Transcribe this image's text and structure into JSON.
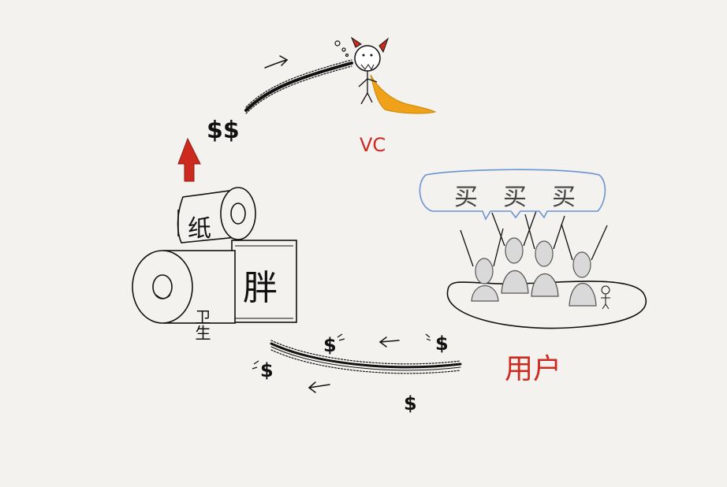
{
  "labels": {
    "vc": "VC",
    "users": "用户",
    "roll_top": "纸",
    "roll_front": "卫生",
    "roll_right": "胖",
    "speech": [
      "买",
      "买",
      "买"
    ],
    "money_top": "$$",
    "dollar": "$"
  },
  "colors": {
    "ink": "#111111",
    "red": "#cc2a1f",
    "orange": "#f0a11a",
    "blue": "#6a93d3",
    "paper": "#f4f2ef"
  },
  "icons": [
    "devil-vc-icon",
    "toilet-paper-icon",
    "crowd-icon",
    "red-arrow-icon"
  ]
}
